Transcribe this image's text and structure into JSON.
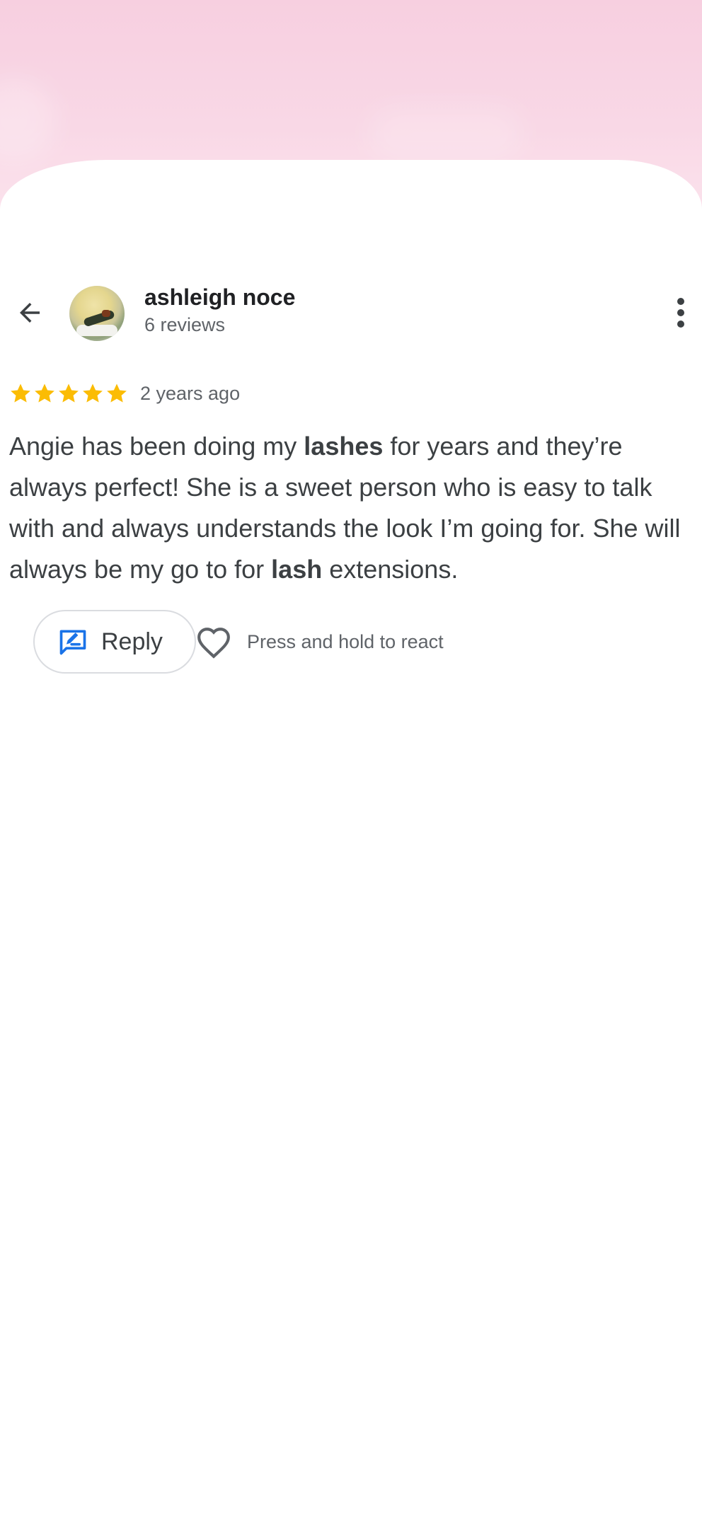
{
  "colors": {
    "background_top": "#f8d3e3",
    "star": "#fbbc04",
    "accent": "#1a73e8",
    "text": "#3c4043",
    "muted": "#5f6368"
  },
  "header": {
    "back_icon": "arrow-left-icon",
    "user_name": "ashleigh noce",
    "review_count": "6 reviews",
    "more_icon": "more-vert-icon"
  },
  "review": {
    "rating": 5,
    "rating_max": 5,
    "time_ago": "2 years ago",
    "text_parts": [
      {
        "text": "Angie has been doing my ",
        "bold": false
      },
      {
        "text": "lashes",
        "bold": true
      },
      {
        "text": " for years and they’re always perfect! She is a sweet person who is easy to talk with and always understands the look I’m going for. She will always be my go to for ",
        "bold": false
      },
      {
        "text": "lash",
        "bold": true
      },
      {
        "text": " extensions.",
        "bold": false
      }
    ]
  },
  "actions": {
    "reply_label": "Reply",
    "reply_icon": "reply-edit-icon",
    "heart_icon": "heart-outline-icon",
    "react_hint": "Press and hold to react"
  }
}
